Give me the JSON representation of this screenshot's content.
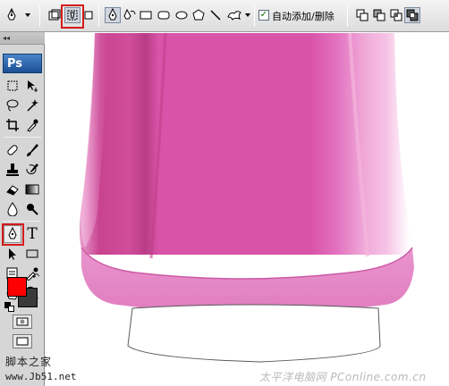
{
  "options_bar": {
    "auto_add_delete_label": "自动添加/删除",
    "auto_add_delete_checked": true,
    "icons": [
      "pen-tool-icon",
      "dropdown-arrow-icon",
      "shape-layers-icon",
      "paths-icon",
      "fill-pixels-icon",
      "pen-icon",
      "freeform-pen-icon",
      "rectangle-icon",
      "rounded-rectangle-icon",
      "ellipse-icon",
      "polygon-icon",
      "line-icon",
      "custom-shape-icon",
      "add-to-path-icon",
      "subtract-from-path-icon",
      "intersect-path-icon",
      "exclude-overlap-icon"
    ]
  },
  "tools_panel": {
    "logo": "Ps",
    "selected_tool": "pen-tool",
    "type_tool_glyph": "T",
    "foreground_color": "#ff0000",
    "background_color": "#3a3a3a"
  },
  "highlight_color": "#d41a1a",
  "canvas": {
    "artwork": "pink-bottle-bottom",
    "colors": {
      "pink_main": "#d94fa7",
      "pink_dark": "#c23c8c",
      "pink_light": "#f0a2d2",
      "pink_base": "#e37dbf"
    }
  },
  "watermarks": {
    "left_line1": "脚本之家",
    "left_line2": "www.Jb51.net",
    "right": "太平洋电脑网 PConline.com.cn"
  }
}
